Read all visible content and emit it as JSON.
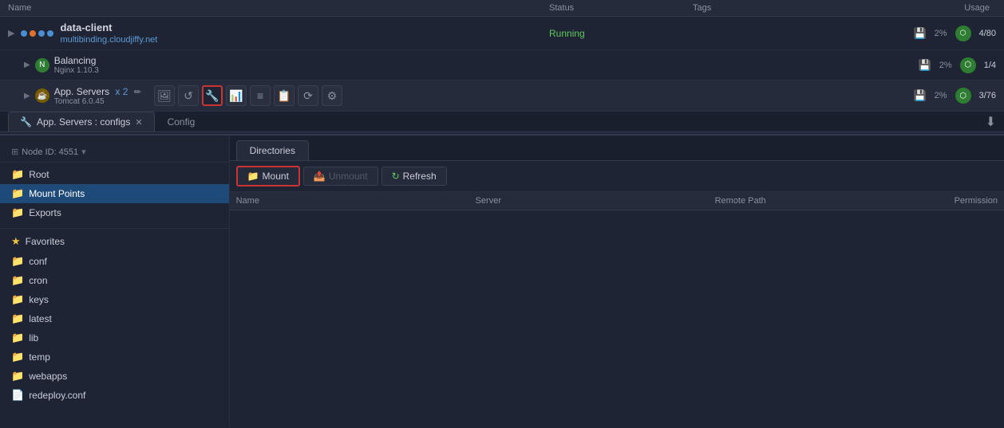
{
  "header": {
    "columns": [
      "Name",
      "Status",
      "Tags",
      "Usage"
    ]
  },
  "environments": [
    {
      "id": "data-client",
      "name": "data-client",
      "url": "multibinding.cloudjiffy.net",
      "status": "Running",
      "tags": "",
      "disk_pct": "2%",
      "usage": "4/80",
      "indent": 0
    },
    {
      "id": "balancing",
      "name": "Balancing",
      "version": "Nginx 1.10.3",
      "status": "",
      "disk_pct": "2%",
      "usage": "1/4",
      "indent": 1
    },
    {
      "id": "app-servers",
      "name": "App. Servers",
      "count": "x 2",
      "version": "Tomcat 6.0.45",
      "status": "",
      "disk_pct": "2%",
      "usage": "3/76",
      "indent": 1
    }
  ],
  "tab": {
    "label": "App. Servers : configs",
    "inner_tab": "Config"
  },
  "sidebar": {
    "node_id_label": "Node ID: 4551",
    "items": [
      {
        "id": "root",
        "label": "Root",
        "icon": "folder"
      },
      {
        "id": "mount-points",
        "label": "Mount Points",
        "icon": "folder",
        "selected": true
      },
      {
        "id": "exports",
        "label": "Exports",
        "icon": "folder"
      }
    ],
    "favorites_label": "Favorites",
    "favorites": [
      {
        "id": "conf",
        "label": "conf"
      },
      {
        "id": "cron",
        "label": "cron"
      },
      {
        "id": "keys",
        "label": "keys"
      },
      {
        "id": "latest",
        "label": "latest"
      },
      {
        "id": "lib",
        "label": "lib"
      },
      {
        "id": "temp",
        "label": "temp"
      },
      {
        "id": "webapps",
        "label": "webapps"
      },
      {
        "id": "redeploy-conf",
        "label": "redeploy.conf"
      }
    ]
  },
  "directories": {
    "tab_label": "Directories",
    "actions": {
      "mount": "Mount",
      "unmount": "Unmount",
      "refresh": "Refresh"
    },
    "table_headers": [
      "Name",
      "Server",
      "Remote Path",
      "Permission"
    ]
  },
  "toolbar_icons": [
    "image",
    "refresh2",
    "wrench",
    "chart",
    "bars",
    "config",
    "cycle",
    "settings"
  ],
  "icons": {
    "expand": "▶",
    "folder": "📁",
    "star": "★",
    "wrench": "🔧",
    "download": "⬇",
    "mount": "📁",
    "unmount": "📤",
    "refresh": "↻",
    "chevron": "▾"
  }
}
